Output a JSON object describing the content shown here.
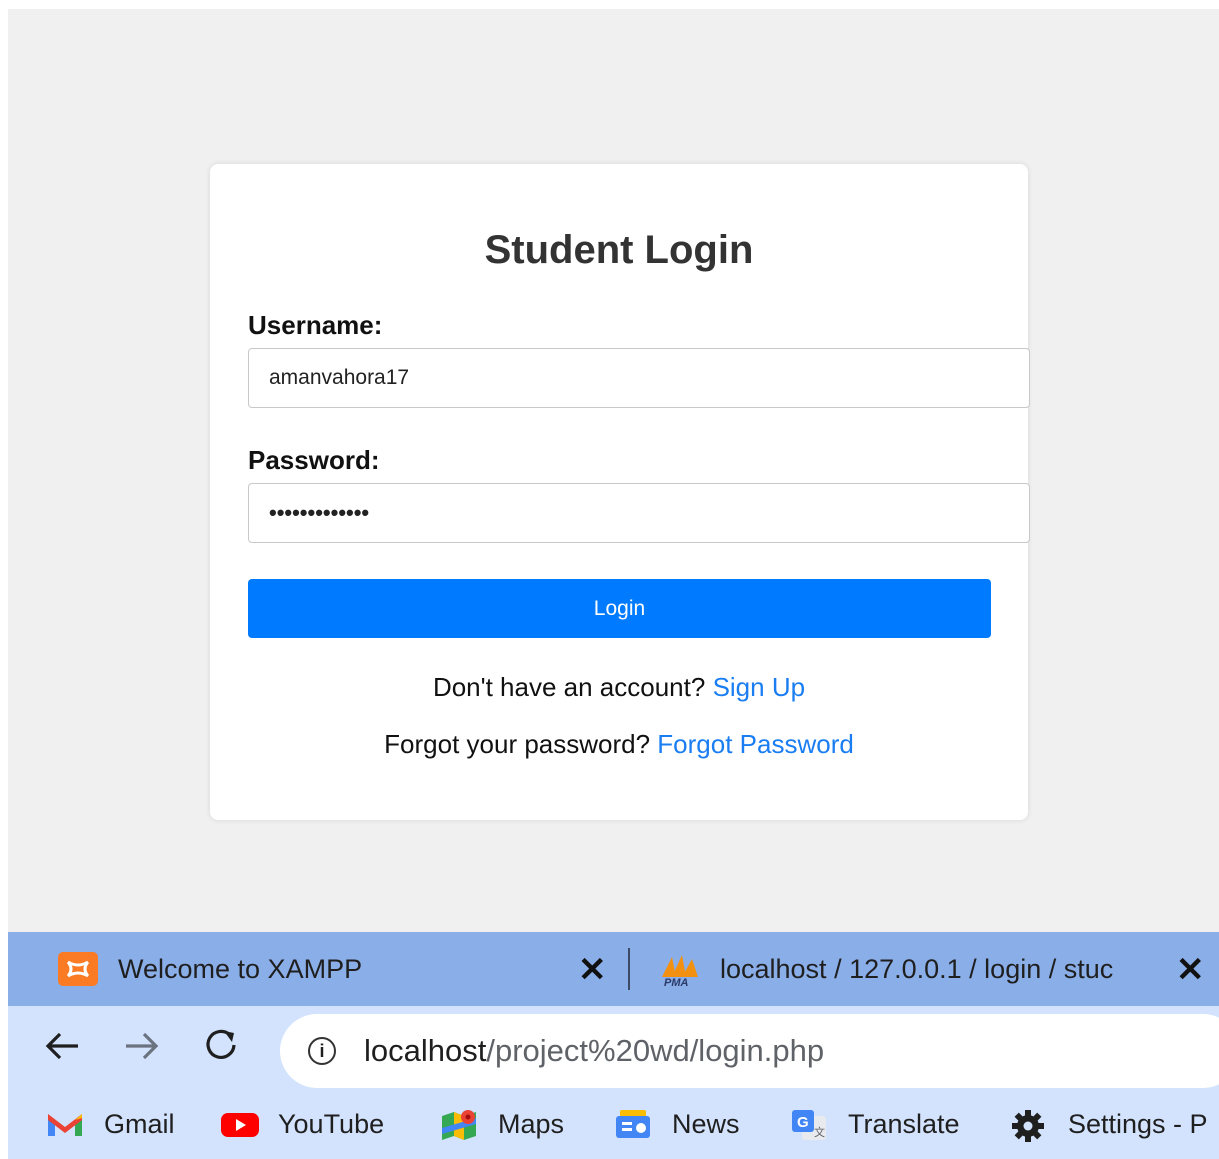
{
  "page": {
    "title": "Student Login",
    "username_label": "Username:",
    "username_value": "amanvahora17",
    "password_label": "Password:",
    "password_value": "•••••••••••••",
    "login_label": "Login",
    "signup_prompt": "Don't have an account?",
    "signup_link": "Sign Up",
    "forgot_prompt": "Forgot your password?",
    "forgot_link": "Forgot Password"
  },
  "browser": {
    "tabs": [
      {
        "title": "Welcome to XAMPP",
        "icon": "xampp-icon"
      },
      {
        "title": "localhost / 127.0.0.1 / login / stuc",
        "icon": "phpmyadmin-icon"
      }
    ],
    "close_glyph": "✕",
    "url_host": "localhost",
    "url_path": "/project%20wd/login.php",
    "bookmarks": [
      {
        "label": "Gmail",
        "icon": "gmail-icon"
      },
      {
        "label": "YouTube",
        "icon": "youtube-icon"
      },
      {
        "label": "Maps",
        "icon": "maps-icon"
      },
      {
        "label": "News",
        "icon": "news-icon"
      },
      {
        "label": "Translate",
        "icon": "translate-icon"
      },
      {
        "label": "Settings - P",
        "icon": "gear-icon"
      }
    ]
  },
  "colors": {
    "primary": "#007bff",
    "link": "#1a7ef2",
    "tabbar": "#8aaee8",
    "toolbar": "#d3e3fd"
  }
}
